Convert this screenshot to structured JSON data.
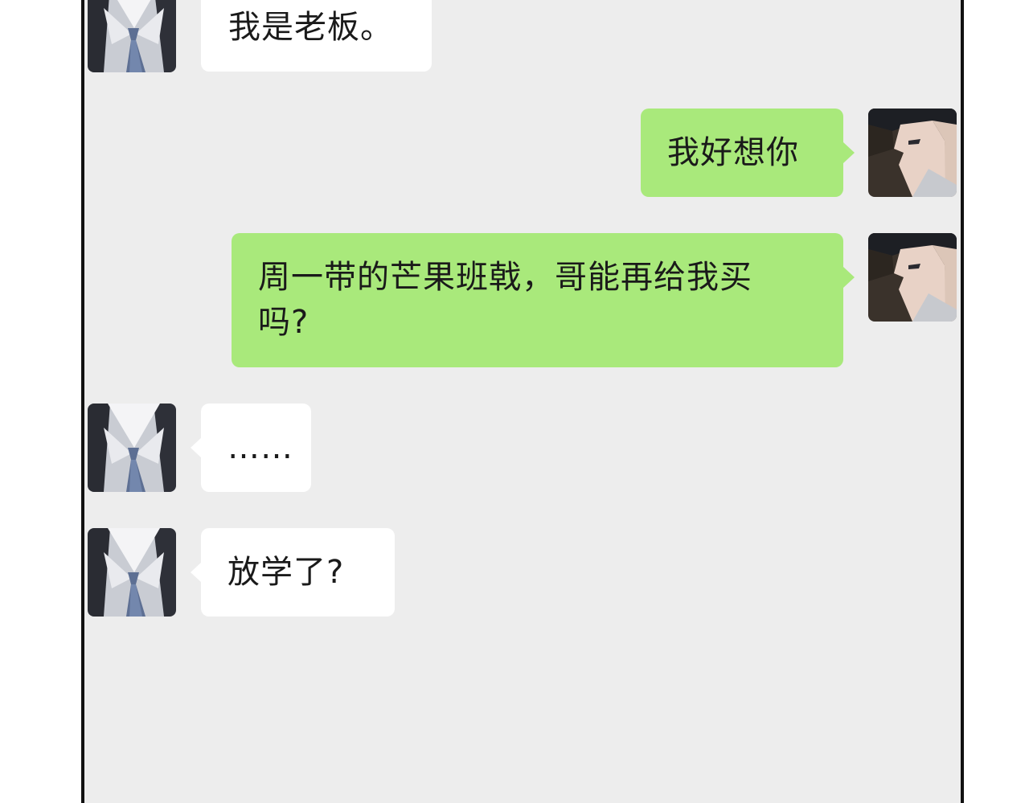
{
  "chat": {
    "messages": [
      {
        "side": "left",
        "sender": "boss",
        "text": "我是老板。"
      },
      {
        "side": "right",
        "sender": "me",
        "text": "我好想你"
      },
      {
        "side": "right",
        "sender": "me",
        "text_line1": "周一带的芒果班戟，哥能再给我买",
        "text_line2": "吗?"
      },
      {
        "side": "left",
        "sender": "boss",
        "text": "……"
      },
      {
        "side": "left",
        "sender": "boss",
        "text": "放学了?"
      }
    ]
  },
  "colors": {
    "background": "#ededed",
    "bubble_left": "#ffffff",
    "bubble_right": "#a9e97b",
    "frame_border": "#111111",
    "text": "#1a1a1a"
  },
  "icons": {
    "left_avatar": "suit-tie-avatar-icon",
    "right_avatar": "profile-face-avatar-icon"
  }
}
